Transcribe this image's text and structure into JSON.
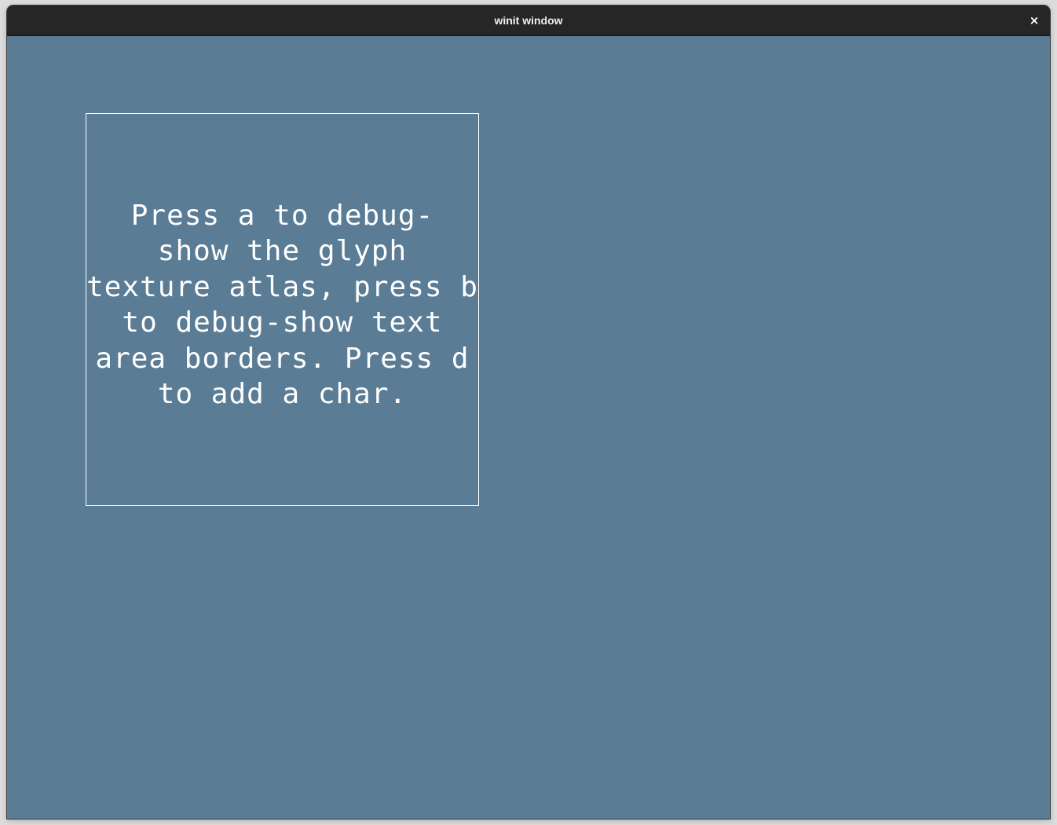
{
  "window": {
    "title": "winit window",
    "close_glyph": "×",
    "background_color": "#5a7c94",
    "titlebar_color": "#262626"
  },
  "text_area": {
    "text": "Press a to debug-\nshow the glyph\ntexture atlas, press b\nto debug-show text\narea borders. Press d\nto add a char.",
    "text_color": "#ffffff",
    "border_color": "#ffffff"
  }
}
